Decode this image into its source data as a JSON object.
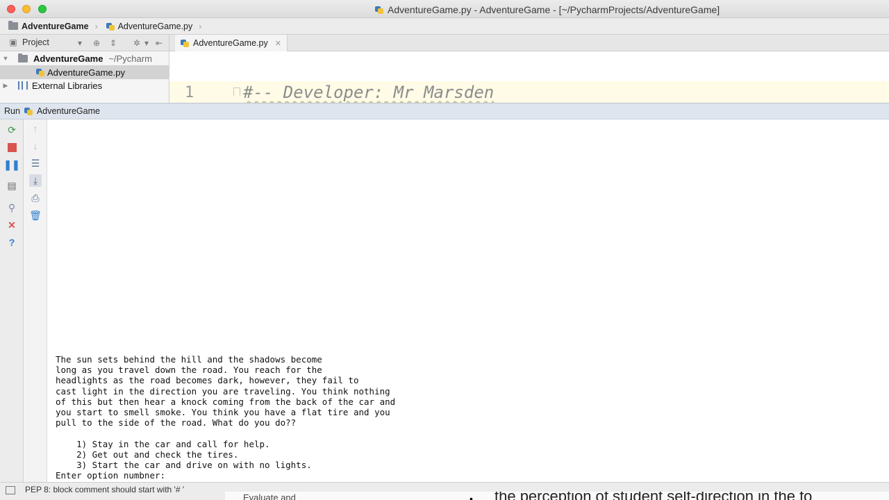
{
  "window": {
    "title": "AdventureGame.py - AdventureGame - [~/PycharmProjects/AdventureGame]"
  },
  "navbar": {
    "project": "AdventureGame",
    "file": "AdventureGame.py"
  },
  "project_panel": {
    "label": "Project"
  },
  "tree": {
    "root_name": "AdventureGame",
    "root_path": "~/Pycharm",
    "file": "AdventureGame.py",
    "libraries": "External Libraries"
  },
  "editor": {
    "tab_label": "AdventureGame.py",
    "line_number": "1",
    "line_text": "#-- Developer: Mr Marsden"
  },
  "run_panel": {
    "label": "Run",
    "config": "AdventureGame"
  },
  "console": {
    "output": "The sun sets behind the hill and the shadows become\nlong as you travel down the road. You reach for the\nheadlights as the road becomes dark, however, they fail to\ncast light in the direction you are traveling. You think nothing\nof this but then hear a knock coming from the back of the car and\nyou start to smell smoke. You think you have a flat tire and you\npull to the side of the road. What do you do??\n\n    1) Stay in the car and call for help.\n    2) Get out and check the tires.\n    3) Start the car and drive on with no lights.\nEnter option numbner: "
  },
  "status": {
    "message": "PEP 8: block comment should start with '# '"
  },
  "background_window": {
    "text_left": "Evaluate and",
    "text_right": "the perception of student self-direction in the fo"
  },
  "colors": {
    "run_header": "#dfe5ee",
    "rerun_green": "#3b9a4c",
    "stop_red": "#d9534f",
    "pause_blue": "#2f7fd0"
  }
}
